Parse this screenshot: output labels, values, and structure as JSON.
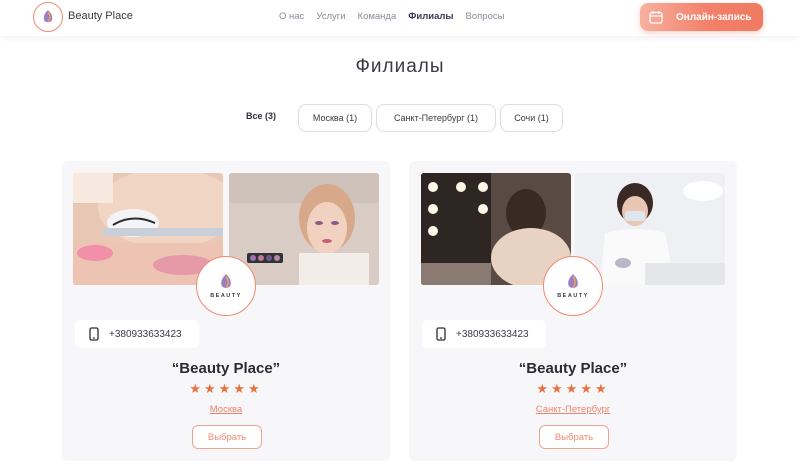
{
  "header": {
    "brand": "Beauty Place",
    "nav": [
      {
        "label": "О нас",
        "active": false
      },
      {
        "label": "Услуги",
        "active": false
      },
      {
        "label": "Команда",
        "active": false
      },
      {
        "label": "Филиалы",
        "active": true
      },
      {
        "label": "Вопросы",
        "active": false
      }
    ],
    "cta_label": "Онлайн-запись",
    "cta_icon": "calendar-icon"
  },
  "page_title": "Филиалы",
  "filters": {
    "all": "Все (3)",
    "chips": [
      "Москва (1)",
      "Санкт-Петербург (1)",
      "Сочи (1)"
    ]
  },
  "cards": [
    {
      "name": "“Beauty Place”",
      "phone": "+380933633423",
      "stars": "★★★★★",
      "rating": 5,
      "city": "Москва",
      "button": "Выбрать",
      "logo_text": "BEAUTY"
    },
    {
      "name": "“Beauty Place”",
      "phone": "+380933633423",
      "stars": "★★★★★",
      "rating": 5,
      "city": "Санкт-Петербург",
      "button": "Выбрать",
      "logo_text": "BEAUTY"
    }
  ],
  "colors": {
    "accent": "#f07a62",
    "star": "#e8713f",
    "card_bg": "#f7f7fa"
  }
}
